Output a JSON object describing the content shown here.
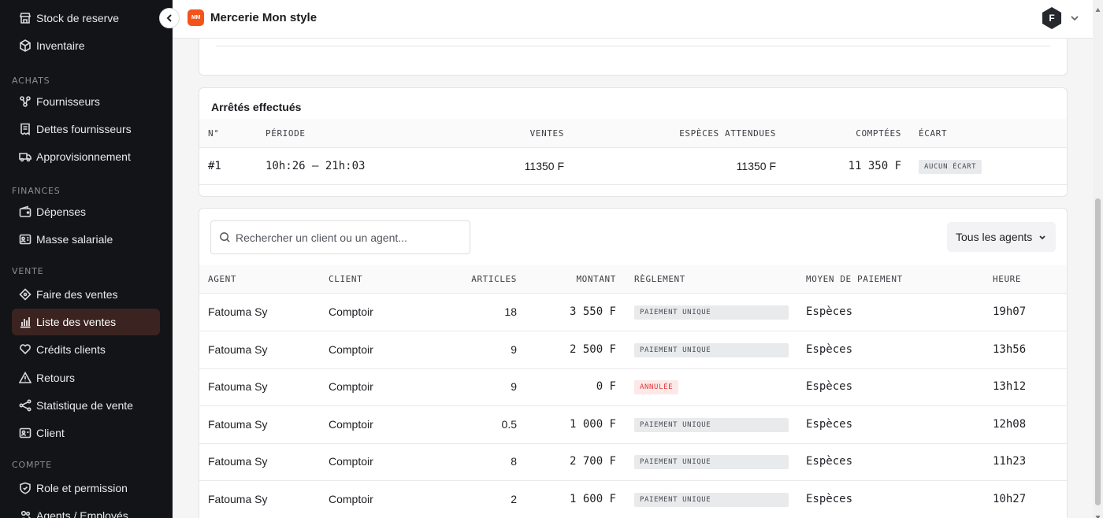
{
  "sidebar": {
    "items_top": [
      {
        "label": "Stock de reserve",
        "icon": "store-icon"
      },
      {
        "label": "Inventaire",
        "icon": "box-icon"
      }
    ],
    "sections": [
      {
        "title": "ACHATS",
        "items": [
          {
            "label": "Fournisseurs",
            "icon": "network-icon"
          },
          {
            "label": "Dettes fournisseurs",
            "icon": "receipt-icon"
          },
          {
            "label": "Approvisionnement",
            "icon": "truck-icon"
          }
        ]
      },
      {
        "title": "FINANCES",
        "items": [
          {
            "label": "Dépenses",
            "icon": "wallet-icon"
          },
          {
            "label": "Masse salariale",
            "icon": "id-card-icon"
          }
        ]
      },
      {
        "title": "VENTE",
        "items": [
          {
            "label": "Faire des ventes",
            "icon": "tag-icon"
          },
          {
            "label": "Liste des ventes",
            "icon": "bar-chart-icon",
            "active": true
          },
          {
            "label": "Crédits clients",
            "icon": "credit-icon"
          },
          {
            "label": "Retours",
            "icon": "warning-icon"
          },
          {
            "label": "Statistique de vente",
            "icon": "share-icon"
          },
          {
            "label": "Client",
            "icon": "contact-icon"
          }
        ]
      },
      {
        "title": "COMPTE",
        "items": [
          {
            "label": "Role et permission",
            "icon": "shield-icon"
          },
          {
            "label": "Agents / Employés",
            "icon": "users-icon"
          }
        ]
      }
    ]
  },
  "header": {
    "logo_text": "MM",
    "shop_name": "Mercerie Mon style",
    "avatar_initial": "F"
  },
  "arrets": {
    "title": "Arrêtés effectués",
    "columns": [
      "N°",
      "PÉRIODE",
      "VENTES",
      "ESPÈCES ATTENDUES",
      "COMPTÉES",
      "ÉCART"
    ],
    "rows": [
      {
        "num": "#1",
        "periode": "10h:26 — 21h:03",
        "ventes": "11350 F",
        "especes": "11350 F",
        "comptees": "11 350 F",
        "ecart": "AUCUN ÉCART"
      }
    ]
  },
  "sales": {
    "search_placeholder": "Rechercher un client ou un agent...",
    "agent_filter": "Tous les agents",
    "columns": [
      "AGENT",
      "CLIENT",
      "ARTICLES",
      "MONTANT",
      "RÈGLEMENT",
      "MOYEN DE PAIEMENT",
      "HEURE"
    ],
    "rows": [
      {
        "agent": "Fatouma Sy",
        "client": "Comptoir",
        "articles": "18",
        "montant": "3 550 F",
        "reglement": "PAIEMENT UNIQUE",
        "status": "ok",
        "moyen": "Espèces",
        "heure": "19h07"
      },
      {
        "agent": "Fatouma Sy",
        "client": "Comptoir",
        "articles": "9",
        "montant": "2 500 F",
        "reglement": "PAIEMENT UNIQUE",
        "status": "ok",
        "moyen": "Espèces",
        "heure": "13h56"
      },
      {
        "agent": "Fatouma Sy",
        "client": "Comptoir",
        "articles": "9",
        "montant": "0 F",
        "reglement": "ANNULÉE",
        "status": "cancelled",
        "moyen": "Espèces",
        "heure": "13h12"
      },
      {
        "agent": "Fatouma Sy",
        "client": "Comptoir",
        "articles": "0.5",
        "montant": "1 000 F",
        "reglement": "PAIEMENT UNIQUE",
        "status": "ok",
        "moyen": "Espèces",
        "heure": "12h08"
      },
      {
        "agent": "Fatouma Sy",
        "client": "Comptoir",
        "articles": "8",
        "montant": "2 700 F",
        "reglement": "PAIEMENT UNIQUE",
        "status": "ok",
        "moyen": "Espèces",
        "heure": "11h23"
      },
      {
        "agent": "Fatouma Sy",
        "client": "Comptoir",
        "articles": "2",
        "montant": "1 600 F",
        "reglement": "PAIEMENT UNIQUE",
        "status": "ok",
        "moyen": "Espèces",
        "heure": "10h27"
      }
    ]
  },
  "colors": {
    "brand": "#f3541c",
    "sidebar_bg": "#121418",
    "active_item_bg": "#3a2320",
    "cancel_red": "#dc3b3b"
  }
}
